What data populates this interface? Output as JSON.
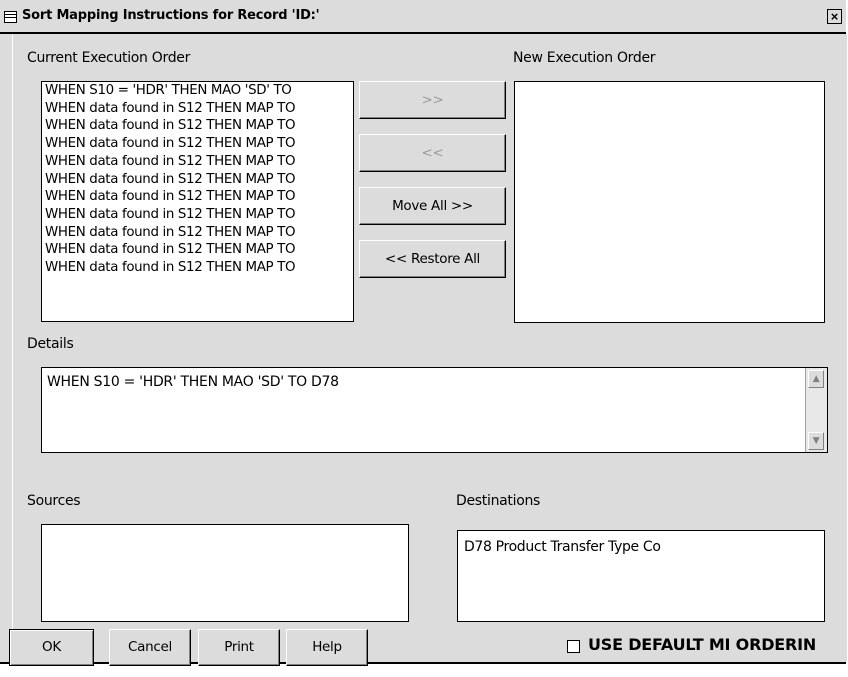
{
  "window": {
    "title": "Sort Mapping Instructions for Record 'ID:'",
    "close_label": "×",
    "app_icon": "window-menu-icon"
  },
  "labels": {
    "current_order": "Current Execution Order",
    "new_order": "New Execution Order",
    "details": "Details",
    "sources": "Sources",
    "destinations": "Destinations"
  },
  "current_order_items": [
    "WHEN S10 = 'HDR' THEN MAO 'SD' TO",
    "WHEN data found in S12 THEN MAP TO",
    "WHEN data found in S12 THEN MAP TO",
    "WHEN data found in S12 THEN MAP TO",
    "WHEN data found in S12 THEN MAP TO",
    "WHEN data found in S12 THEN MAP TO",
    "WHEN data found in S12 THEN MAP TO",
    "WHEN data found in S12 THEN MAP TO",
    "WHEN data found in S12 THEN MAP TO",
    "WHEN data found in S12 THEN MAP TO",
    "WHEN data found in S12 THEN MAP TO"
  ],
  "transfer_buttons": {
    "move_right": ">>",
    "move_left": "<<",
    "move_all": "Move All >>",
    "restore_all": "<< Restore All"
  },
  "details_text": "WHEN S10 = 'HDR' THEN MAO 'SD' TO D78",
  "destinations_items": [
    "D78 Product Transfer Type Co"
  ],
  "footer": {
    "ok": "OK",
    "cancel": "Cancel",
    "print": "Print",
    "help": "Help",
    "default_order_label": "USE DEFAULT MI ORDERIN",
    "default_order_checked": false
  },
  "icons": {
    "scroll_up": "scroll-up-arrow-icon",
    "scroll_down": "scroll-down-arrow-icon"
  }
}
